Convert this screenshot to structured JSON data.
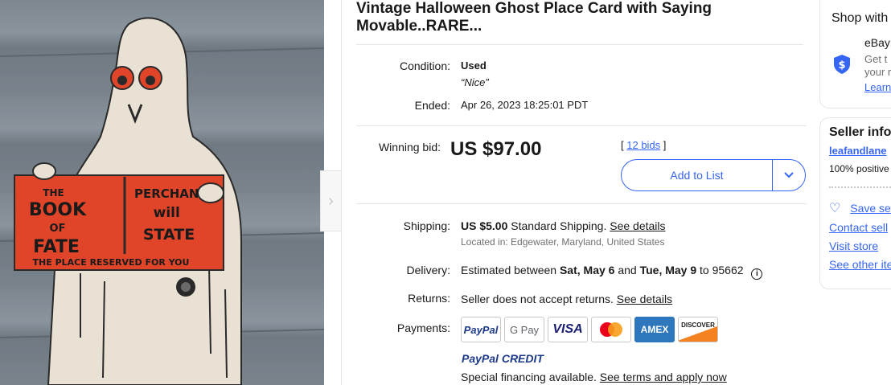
{
  "listing": {
    "title": "Vintage Halloween Ghost Place Card with Saying Movable..RARE..."
  },
  "photo": {
    "book_left": "THE BOOK OF FATE",
    "book_right": "PERCHANCE will STATE",
    "book_bottom": "THE PLACE RESERVED FOR YOU"
  },
  "condition": {
    "label": "Condition:",
    "value": "Used",
    "note": "“Nice”"
  },
  "ended": {
    "label": "Ended:",
    "value": "Apr 26, 2023 18:25:01 PDT"
  },
  "bid": {
    "label": "Winning bid:",
    "price": "US $97.00",
    "bids_prefix": "[",
    "bids_link": "12 bids",
    "bids_suffix": "]",
    "add_to_list": "Add to List"
  },
  "shipping": {
    "label": "Shipping:",
    "price": "US $5.00",
    "method": "Standard Shipping.",
    "details_link": "See details",
    "location": "Located in: Edgewater, Maryland, United States"
  },
  "delivery": {
    "label": "Delivery:",
    "prefix": "Estimated between",
    "date1": "Sat, May 6",
    "and": "and",
    "date2": "Tue, May 9",
    "to": "to 95662"
  },
  "returns": {
    "label": "Returns:",
    "text": "Seller does not accept returns.",
    "details_link": "See details"
  },
  "payments": {
    "label": "Payments:",
    "methods": [
      "PayPal",
      "G Pay",
      "VISA",
      "Mastercard",
      "AMEX",
      "DISCOVER"
    ],
    "paypal_credit": "PayPal CREDIT",
    "financing_text": "Special financing available.",
    "financing_link": "See terms and apply now"
  },
  "shop_card": {
    "title": "Shop with",
    "line1": "eBay",
    "line2": "Get t",
    "line3": "your r",
    "learn": "Learn"
  },
  "seller_card": {
    "title": "Seller info",
    "name": "leafandlane",
    "feedback": "100% positive",
    "save": "Save se",
    "contact": "Contact sell",
    "visit": "Visit store",
    "other": "See other ite"
  },
  "colors": {
    "link_blue": "#3665f3",
    "divider": "#e5e5e5",
    "book_red": "#e0452a"
  }
}
